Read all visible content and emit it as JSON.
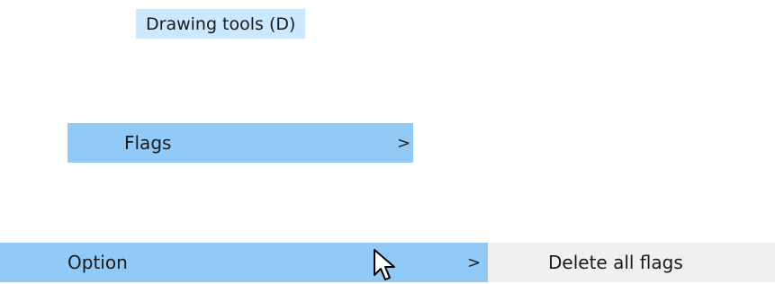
{
  "tooltip": {
    "text": "Drawing tools (D)"
  },
  "menu": {
    "flags": {
      "label": "Flags",
      "chevron": ">"
    },
    "option": {
      "label": "Option",
      "chevron": ">"
    },
    "submenu": {
      "delete_all_flags": "Delete all flags"
    }
  },
  "icons": {
    "submenu_arrow": "chevron-right-icon",
    "cursor": "mouse-pointer-icon"
  },
  "colors": {
    "highlight": "#91c9f7",
    "tooltip_bg": "#cce8ff",
    "submenu_bg": "#f0f0f0"
  }
}
